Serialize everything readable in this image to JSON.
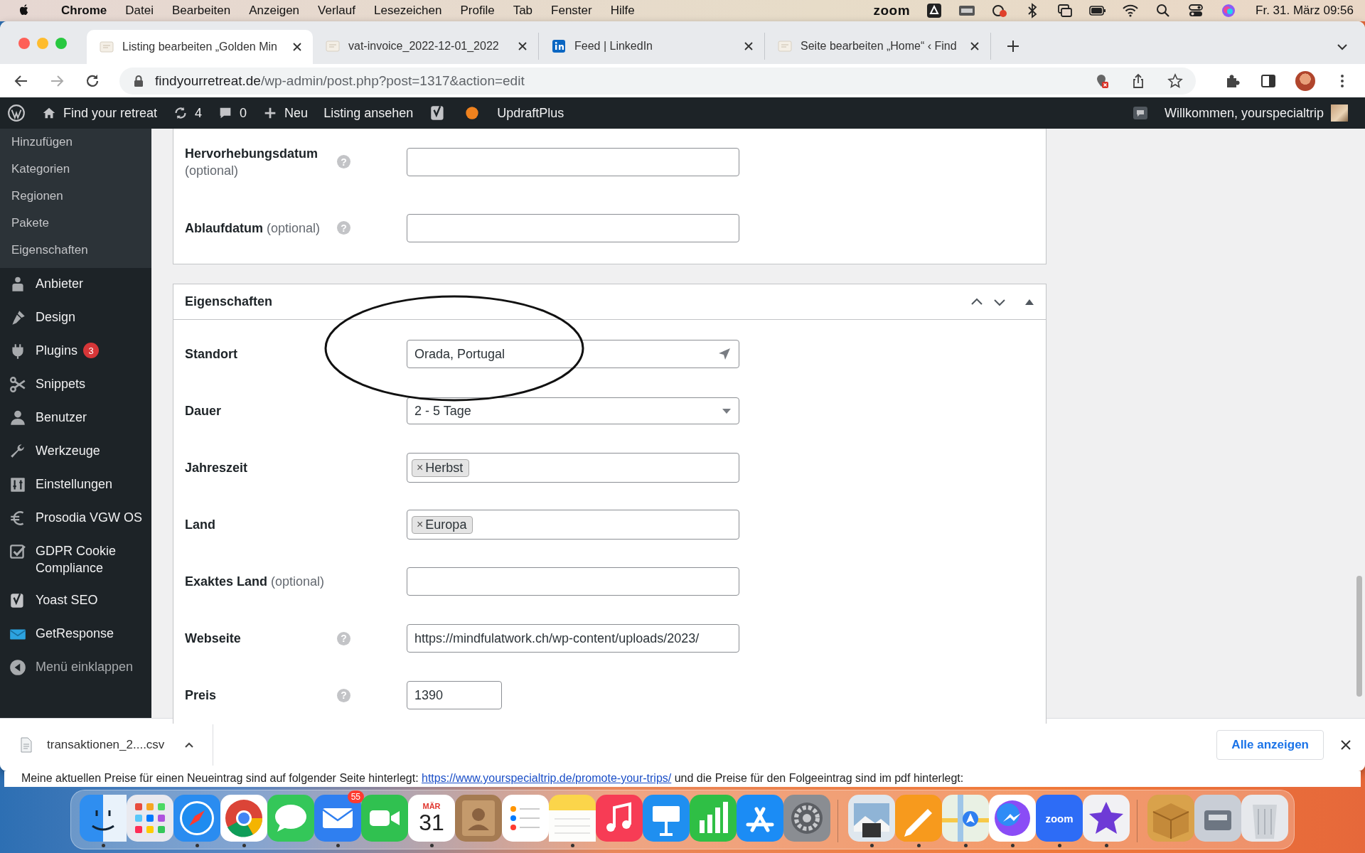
{
  "menu_bar": {
    "app": "Chrome",
    "items": [
      "Datei",
      "Bearbeiten",
      "Anzeigen",
      "Verlauf",
      "Lesezeichen",
      "Profile",
      "Tab",
      "Fenster",
      "Hilfe"
    ],
    "status_items": [
      {
        "kind": "text",
        "text": "zoom"
      },
      {
        "kind": "drive"
      },
      {
        "kind": "disk"
      },
      {
        "kind": "cloud"
      },
      {
        "kind": "bluetooth"
      },
      {
        "kind": "mirror"
      },
      {
        "kind": "battery"
      },
      {
        "kind": "wifi"
      },
      {
        "kind": "search"
      },
      {
        "kind": "control"
      },
      {
        "kind": "siri"
      }
    ],
    "clock": "Fr. 31. März  09:56"
  },
  "tabs": [
    {
      "title": "Listing bearbeiten „Golden Min",
      "selected": true,
      "kind": "page"
    },
    {
      "title": "vat-invoice_2022-12-01_2022",
      "selected": false,
      "kind": "page"
    },
    {
      "title": "Feed | LinkedIn",
      "selected": false,
      "kind": "linkedin"
    },
    {
      "title": "Seite bearbeiten „Home“ ‹ Find",
      "selected": false,
      "kind": "page"
    }
  ],
  "address_bar": {
    "host": "findyourretreat.de",
    "path": "/wp-admin/post.php?post=1317&action=edit"
  },
  "admin_bar": {
    "items": [
      {
        "kind": "wordpress"
      },
      {
        "kind": "home",
        "text": "Find your retreat"
      },
      {
        "kind": "refresh",
        "text": "4"
      },
      {
        "kind": "comment",
        "text": "0"
      },
      {
        "kind": "plus",
        "text": "Neu"
      },
      {
        "kind": "none",
        "text": "Listing ansehen"
      },
      {
        "kind": "yoast"
      },
      {
        "kind": "dot"
      },
      {
        "kind": "none",
        "text": "UpdraftPlus"
      }
    ],
    "greeting": "Willkommen, yourspecialtrip"
  },
  "sidebar": {
    "submenu": [
      "Hinzufügen",
      "Kategorien",
      "Regionen",
      "Pakete",
      "Eigenschaften"
    ],
    "items": [
      {
        "kind": "person",
        "label": "Anbieter"
      },
      {
        "kind": "brush",
        "label": "Design"
      },
      {
        "kind": "plug",
        "label": "Plugins",
        "badge": "3"
      },
      {
        "kind": "scissors",
        "label": "Snippets"
      },
      {
        "kind": "user",
        "label": "Benutzer"
      },
      {
        "kind": "wrench",
        "label": "Werkzeuge"
      },
      {
        "kind": "sliders",
        "label": "Einstellungen"
      },
      {
        "kind": "euro",
        "label": "Prosodia VGW OS"
      },
      {
        "kind": "check",
        "label": "GDPR Cookie Compliance"
      },
      {
        "kind": "yoast",
        "label": "Yoast SEO"
      },
      {
        "kind": "mail",
        "label": "GetResponse"
      },
      {
        "kind": "collapse",
        "label": "Menü einklappen"
      }
    ]
  },
  "panel_top": {
    "rows": [
      {
        "kind": "text",
        "label": "Hervorhebungsdatum",
        "note": "(optional)",
        "help": "?",
        "value": ""
      },
      {
        "kind": "text",
        "label": "Ablaufdatum",
        "note": "(optional)",
        "help": "?",
        "value": ""
      }
    ]
  },
  "panel_properties": {
    "title": "Eigenschaften",
    "rows": [
      {
        "kind": "location",
        "label": "Standort",
        "value": "Orada, Portugal"
      },
      {
        "kind": "select",
        "label": "Dauer",
        "value": "2 - 5 Tage"
      },
      {
        "kind": "tags",
        "label": "Jahreszeit",
        "tags": [
          {
            "remove": "×",
            "label": "Herbst"
          }
        ]
      },
      {
        "kind": "tags",
        "label": "Land",
        "tags": [
          {
            "remove": "×",
            "label": "Europa"
          }
        ]
      },
      {
        "kind": "text",
        "label": "Exaktes Land",
        "note": "(optional)",
        "value": ""
      },
      {
        "kind": "text",
        "label": "Webseite",
        "help": "?",
        "value": "https://mindfulatwork.ch/wp-content/uploads/2023/"
      },
      {
        "kind": "price",
        "label": "Preis",
        "help": "?",
        "value": "1390"
      }
    ]
  },
  "download_bar": {
    "file": "transaktionen_2....csv",
    "show_all": "Alle anzeigen"
  },
  "background_window": {
    "text": "Meine aktuellen Preise für einen Neueintrag sind auf folgender Seite hinterlegt:",
    "link": "https://www.yourspecialtrip.de/promote-your-trips/",
    "text_after": "und die Preise für den Folgeeintrag sind im pdf hinterlegt:"
  },
  "dock": [
    {
      "kind": "finder",
      "color": "#2f8ef0",
      "running": true
    },
    {
      "kind": "grid",
      "color": "#e9e9ef",
      "running": false
    },
    {
      "kind": "compass",
      "color": "#2a8cf0",
      "running": true
    },
    {
      "kind": "chrome",
      "color": "#ffffff",
      "running": true
    },
    {
      "kind": "bubble",
      "color": "#34c759",
      "running": false
    },
    {
      "kind": "mail",
      "color": "#2f7ff0",
      "running": true,
      "badge": "55"
    },
    {
      "kind": "video",
      "color": "#30c150",
      "running": false
    },
    {
      "kind": "calendar",
      "color": "#ffffff",
      "running": true,
      "month": "MÄR",
      "day": "31"
    },
    {
      "kind": "person",
      "color": "#a57b52",
      "running": false
    },
    {
      "kind": "list",
      "color": "#ffffff",
      "running": false
    },
    {
      "kind": "note",
      "color": "#fbd54a",
      "running": true
    },
    {
      "kind": "music",
      "color": "#f73c55",
      "running": false
    },
    {
      "kind": "podium",
      "color": "#1f8ff0",
      "running": false
    },
    {
      "kind": "bars",
      "color": "#2fbf45",
      "running": false
    },
    {
      "kind": "appstore",
      "color": "#1b8cf5",
      "running": false
    },
    {
      "kind": "gear",
      "color": "#8a8d92",
      "running": false
    },
    {
      "kind": "separator"
    },
    {
      "kind": "photo",
      "color": "#dfe7ee",
      "running": true
    },
    {
      "kind": "pencil",
      "color": "#f79a1d",
      "running": true
    },
    {
      "kind": "map",
      "color": "#e9f1e4",
      "running": true
    },
    {
      "kind": "messenger",
      "color": "#ffffff",
      "running": true
    },
    {
      "kind": "zoom",
      "color": "#2d6cf6",
      "running": true,
      "label": "zoom"
    },
    {
      "kind": "star",
      "color": "#f1f1f4",
      "running": true
    },
    {
      "kind": "separator"
    },
    {
      "kind": "box",
      "color": "#d9a24b",
      "running": false
    },
    {
      "kind": "drive",
      "color": "#c9ced6",
      "running": false
    },
    {
      "kind": "trash",
      "color": "#e6e8ec",
      "running": false
    }
  ]
}
